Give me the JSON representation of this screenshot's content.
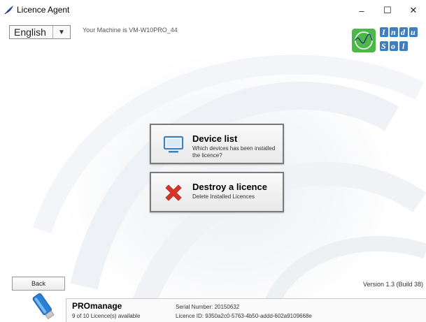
{
  "window": {
    "title": "Licence Agent",
    "minimize": "–",
    "maximize": "☐",
    "close": "✕"
  },
  "header": {
    "language": "English",
    "machine_text": "Your Machine is  VM-W10PRO_44",
    "logo_letters": [
      "I",
      "n",
      "d",
      "u",
      "S",
      "o",
      "l"
    ]
  },
  "actions": [
    {
      "title": "Device list",
      "subtitle": "Which devices has been installed the licence?",
      "icon": "monitor-icon"
    },
    {
      "title": "Destroy a licence",
      "subtitle": "Delete Installed Licences",
      "icon": "red-x-icon"
    }
  ],
  "footer": {
    "back_label": "Back",
    "version": "Version 1.3 (Build 38)",
    "product_name": "PROmanage",
    "licence_count": "9 of 10 Licence(s) available",
    "serial": "Serial Number: 20150632",
    "licence_id": "Licence ID: 9350a2c0-5763-4b50-addd-602a9109668e"
  },
  "colors": {
    "accent_blue": "#3f7fbf",
    "destroy_red": "#d9362a",
    "logo_green": "#4db848"
  }
}
